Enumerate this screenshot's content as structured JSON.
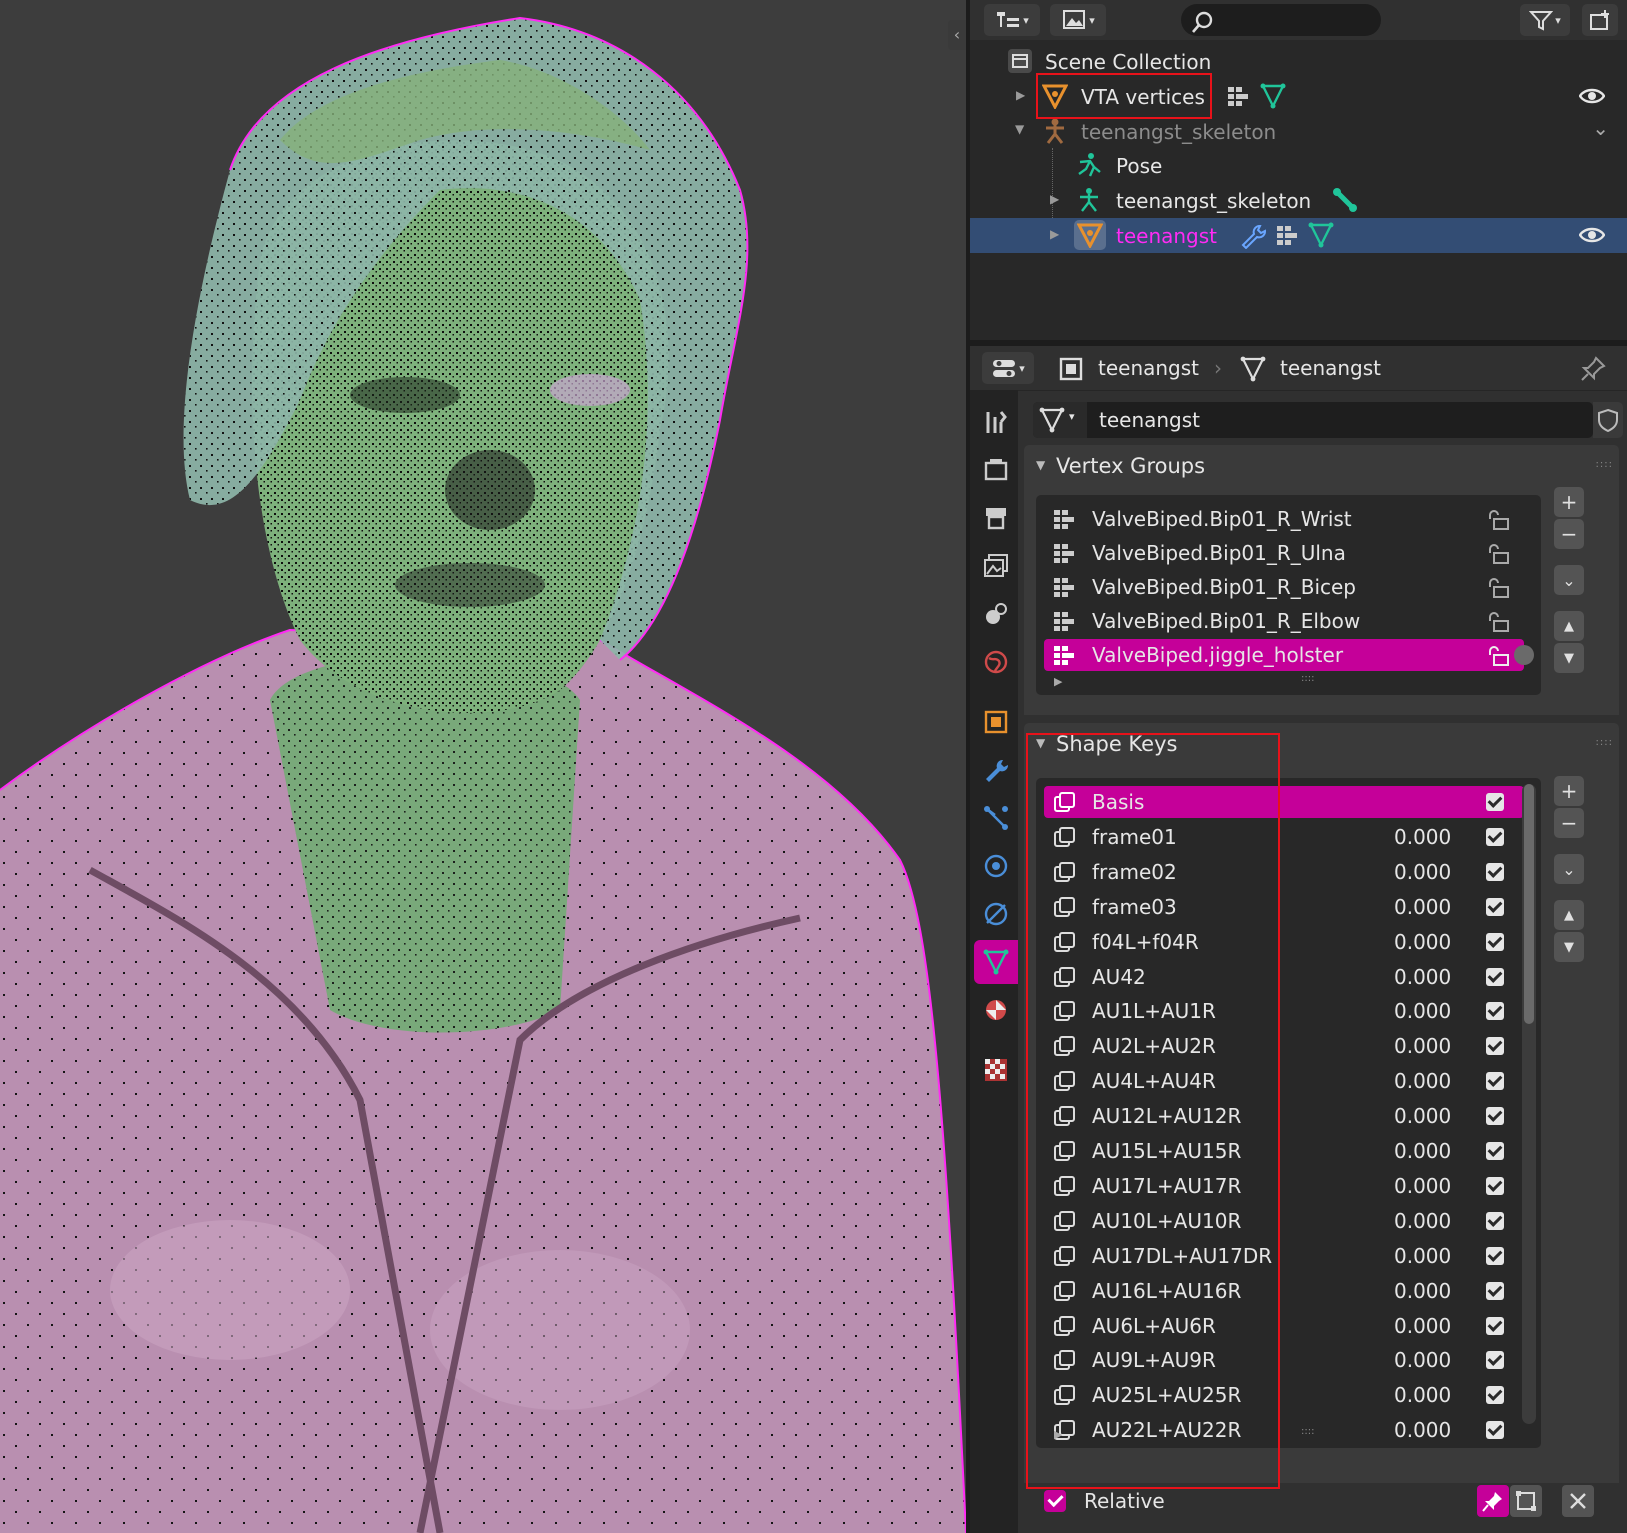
{
  "outliner": {
    "rows": [
      {
        "label": "Scene Collection"
      },
      {
        "label": "VTA vertices"
      },
      {
        "label": "teenangst_skeleton"
      },
      {
        "label": "Pose"
      },
      {
        "label": "teenangst_skeleton"
      },
      {
        "label": "teenangst"
      }
    ]
  },
  "properties": {
    "breadcrumb": [
      "teenangst",
      "teenangst"
    ],
    "mesh_name": "teenangst",
    "vertex_groups": {
      "title": "Vertex Groups",
      "items": [
        "ValveBiped.Bip01_R_Wrist",
        "ValveBiped.Bip01_R_Ulna",
        "ValveBiped.Bip01_R_Bicep",
        "ValveBiped.Bip01_R_Elbow",
        "ValveBiped.jiggle_holster"
      ],
      "selected": "ValveBiped.jiggle_holster"
    },
    "shape_keys": {
      "title": "Shape Keys",
      "items": [
        {
          "name": "Basis",
          "value": ""
        },
        {
          "name": "frame01",
          "value": "0.000"
        },
        {
          "name": "frame02",
          "value": "0.000"
        },
        {
          "name": "frame03",
          "value": "0.000"
        },
        {
          "name": "f04L+f04R",
          "value": "0.000"
        },
        {
          "name": "AU42",
          "value": "0.000"
        },
        {
          "name": "AU1L+AU1R",
          "value": "0.000"
        },
        {
          "name": "AU2L+AU2R",
          "value": "0.000"
        },
        {
          "name": "AU4L+AU4R",
          "value": "0.000"
        },
        {
          "name": "AU12L+AU12R",
          "value": "0.000"
        },
        {
          "name": "AU15L+AU15R",
          "value": "0.000"
        },
        {
          "name": "AU17L+AU17R",
          "value": "0.000"
        },
        {
          "name": "AU10L+AU10R",
          "value": "0.000"
        },
        {
          "name": "AU17DL+AU17DR",
          "value": "0.000"
        },
        {
          "name": "AU16L+AU16R",
          "value": "0.000"
        },
        {
          "name": "AU6L+AU6R",
          "value": "0.000"
        },
        {
          "name": "AU9L+AU9R",
          "value": "0.000"
        },
        {
          "name": "AU25L+AU25R",
          "value": "0.000"
        },
        {
          "name": "AU22L+AU22R",
          "value": "0.000"
        }
      ],
      "selected": "Basis",
      "relative_label": "Relative"
    }
  },
  "colors": {
    "accent": "#c50099",
    "outliner_active": "#334d74",
    "highlight_box": "#e8121a",
    "mesh_icon": "#e8912d",
    "data_icon": "#20c59a"
  }
}
